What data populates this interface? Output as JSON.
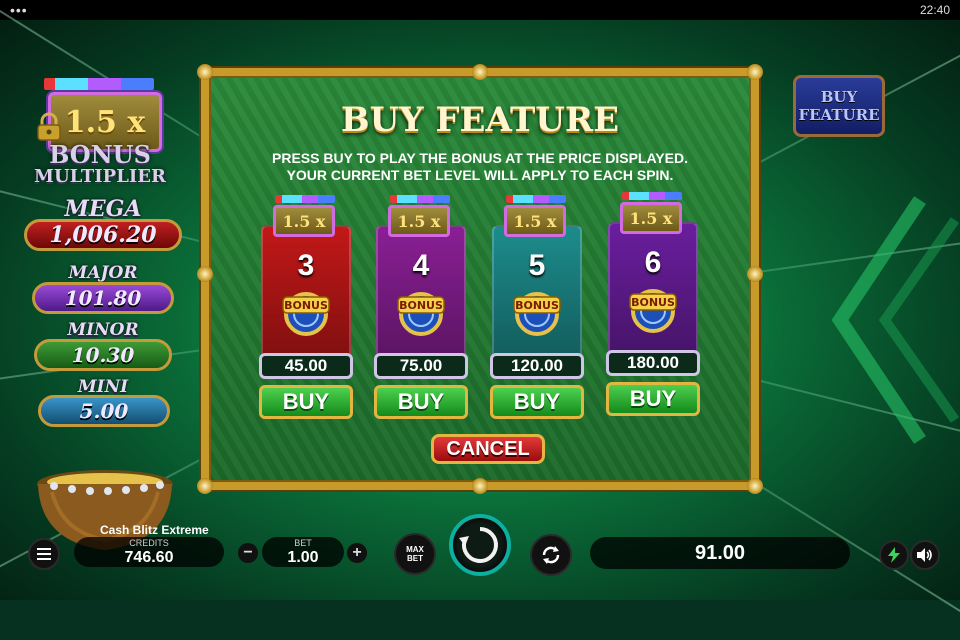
{
  "status_bar": {
    "menu_dots": "•••",
    "time": "22:40"
  },
  "jackpots": {
    "bonus_multiplier_value": "1.5 x",
    "bonus_multiplier_title_line1": "BONUS",
    "bonus_multiplier_title_line2": "MULTIPLIER",
    "mega": {
      "label": "MEGA",
      "value": "1,006.20"
    },
    "major": {
      "label": "MAJOR",
      "value": "101.80"
    },
    "minor": {
      "label": "MINOR",
      "value": "10.30"
    },
    "mini": {
      "label": "MINI",
      "value": "5.00"
    }
  },
  "buy_feature_button": {
    "line1": "BUY",
    "line2": "FEATURE"
  },
  "modal": {
    "title": "BUY FEATURE",
    "desc_line1": "PRESS BUY TO PLAY THE BONUS AT THE PRICE DISPLAYED.",
    "desc_line2": "YOUR CURRENT BET LEVEL WILL APPLY TO EACH SPIN.",
    "options": [
      {
        "multiplier": "1.5 x",
        "count": "3",
        "bonus_text": "BONUS",
        "price": "45.00",
        "buy_label": "BUY",
        "color": "#c21818"
      },
      {
        "multiplier": "1.5 x",
        "count": "4",
        "bonus_text": "BONUS",
        "price": "75.00",
        "buy_label": "BUY",
        "color": "#8a1f95"
      },
      {
        "multiplier": "1.5 x",
        "count": "5",
        "bonus_text": "BONUS",
        "price": "120.00",
        "buy_label": "BUY",
        "color": "#1d8c8c"
      },
      {
        "multiplier": "1.5 x",
        "count": "6",
        "bonus_text": "BONUS",
        "price": "180.00",
        "buy_label": "BUY",
        "color": "#6a1e9e"
      }
    ],
    "cancel_label": "CANCEL"
  },
  "bottom_bar": {
    "game_name": "Cash Blitz Extreme",
    "credits_label": "CREDITS",
    "credits_value": "746.60",
    "bet_label": "BET",
    "bet_value": "1.00",
    "minus_label": "−",
    "plus_label": "+",
    "maxbet_line1": "MAX",
    "maxbet_line2": "BET",
    "win_value": "91.00"
  },
  "icons": {
    "menu": "hamburger-icon",
    "spin": "spin-arrow-icon",
    "autoplay": "autoplay-icon",
    "turbo": "lightning-icon",
    "sound": "speaker-icon",
    "lock": "padlock-icon",
    "pot": "pot-of-gold-icon"
  },
  "colors": {
    "accent_gold": "#c79a2a",
    "buy_green": "#148a1b",
    "cancel_red": "#9a0c0c",
    "spin_teal": "#0bb0a0"
  }
}
